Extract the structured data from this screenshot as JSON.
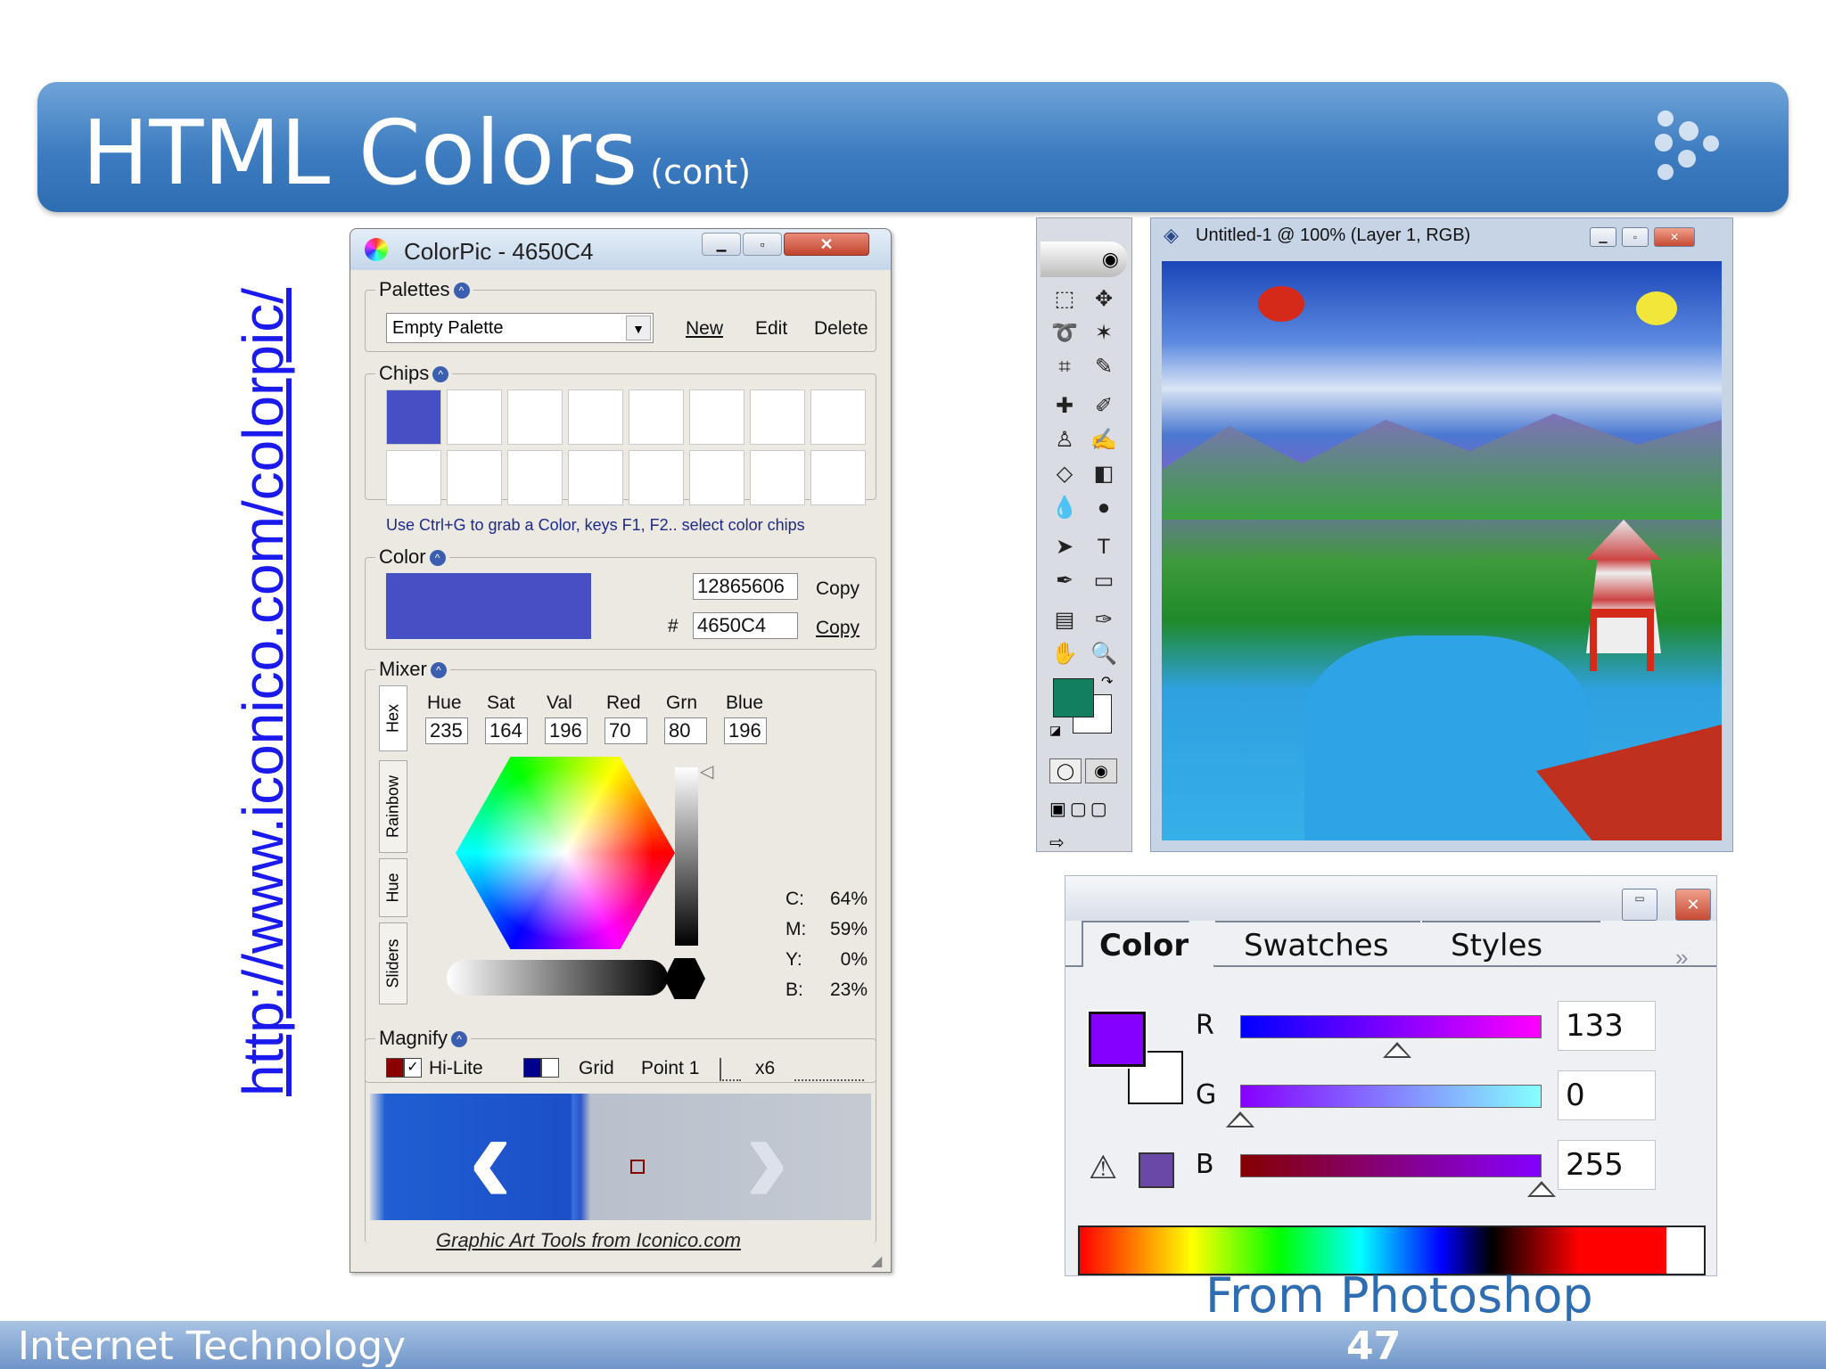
{
  "slide": {
    "title": "HTML Colors",
    "title_sub": "(cont)",
    "url": "http://www.iconico.com/colorpic/",
    "caption": "From Photoshop",
    "footer_left": "Internet Technology",
    "page_number": "47"
  },
  "colorpic": {
    "window_title": "ColorPic - 4650C4",
    "palettes": {
      "label": "Palettes",
      "selected": "Empty Palette",
      "buttons": [
        "New",
        "Edit",
        "Delete"
      ]
    },
    "chips": {
      "label": "Chips",
      "first_chip_color": "#4650C4",
      "hint": "Use Ctrl+G to grab a Color, keys F1, F2.. select color chips"
    },
    "color": {
      "label": "Color",
      "swatch": "#4650C4",
      "decimal": "12865606",
      "hash_label": "#",
      "hex": "4650C4",
      "copy_label": "Copy"
    },
    "mixer": {
      "label": "Mixer",
      "tabs": [
        "Hex",
        "Rainbow",
        "Hue",
        "Sliders"
      ],
      "fields": [
        {
          "label": "Hue",
          "value": "235"
        },
        {
          "label": "Sat",
          "value": "164"
        },
        {
          "label": "Val",
          "value": "196"
        },
        {
          "label": "Red",
          "value": "70"
        },
        {
          "label": "Grn",
          "value": "80"
        },
        {
          "label": "Blue",
          "value": "196"
        }
      ],
      "cmyk": [
        {
          "label": "C:",
          "value": "64%"
        },
        {
          "label": "M:",
          "value": "59%"
        },
        {
          "label": "Y:",
          "value": "0%"
        },
        {
          "label": "B:",
          "value": "23%"
        }
      ]
    },
    "magnify": {
      "label": "Magnify",
      "hilite": "Hi-Lite",
      "grid": "Grid",
      "point": "Point 1",
      "zoom": "x6"
    },
    "footer_link": "Graphic Art Tools from Iconico.com"
  },
  "photoshop": {
    "doc_title": "Untitled-1 @ 100% (Layer 1, RGB)",
    "foreground_color": "#128060",
    "color_panel": {
      "tabs": [
        "Color",
        "Swatches",
        "Styles"
      ],
      "swatch": "#8500FF",
      "channels": [
        {
          "label": "R",
          "value": "133"
        },
        {
          "label": "G",
          "value": "0"
        },
        {
          "label": "B",
          "value": "255"
        }
      ]
    }
  }
}
